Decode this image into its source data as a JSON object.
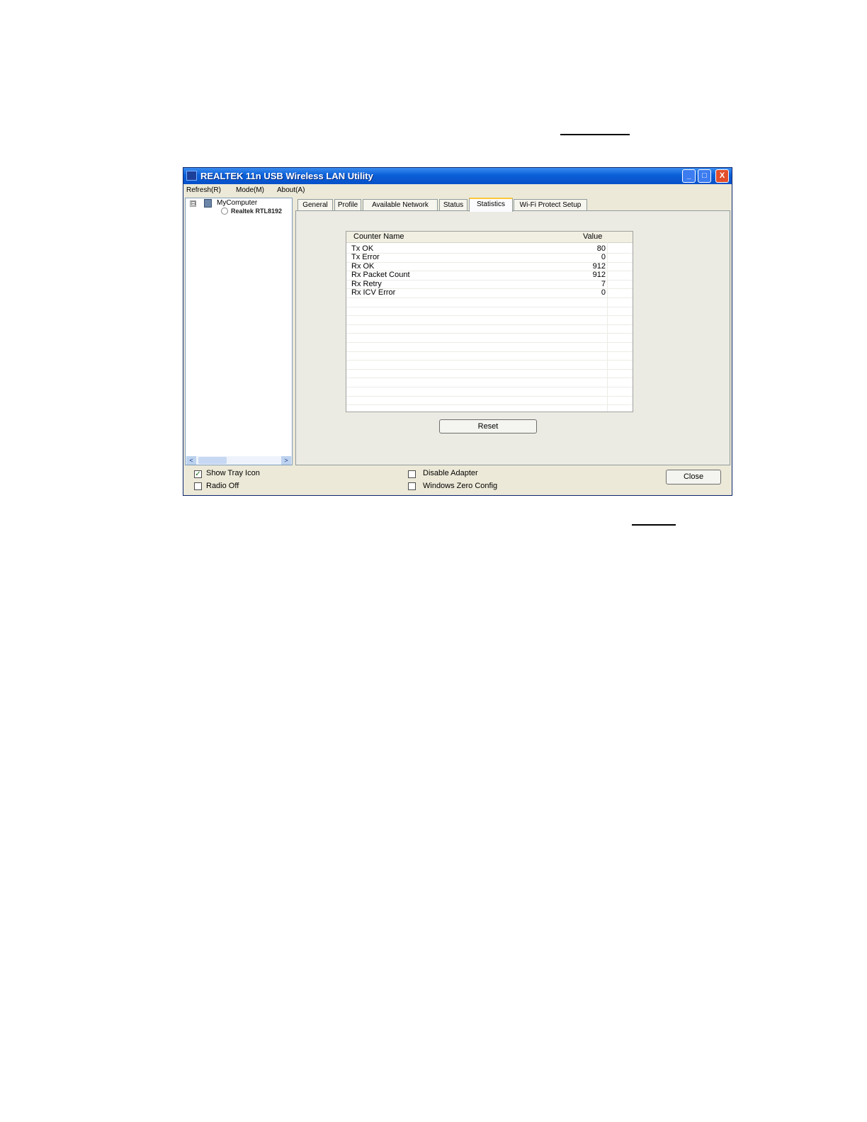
{
  "window": {
    "title": "REALTEK 11n USB Wireless LAN Utility",
    "controls": {
      "minimize": "_",
      "maximize": "□",
      "close": "X"
    }
  },
  "menu": [
    "Refresh(R)",
    "Mode(M)",
    "About(A)"
  ],
  "tree": {
    "expander": "⊟",
    "root": "MyComputer",
    "child": "Realtek RTL8192"
  },
  "scrollbar": {
    "left": "<",
    "right": ">"
  },
  "tabs": [
    {
      "label": "General"
    },
    {
      "label": "Profile"
    },
    {
      "label": "Available Network"
    },
    {
      "label": "Status"
    },
    {
      "label": "Statistics",
      "active": true
    },
    {
      "label": "Wi-Fi Protect Setup"
    }
  ],
  "statistics": {
    "columns": {
      "name": "Counter Name",
      "value": "Value"
    },
    "rows": [
      {
        "name": "Tx OK",
        "value": "80"
      },
      {
        "name": "Tx Error",
        "value": "0"
      },
      {
        "name": "Rx OK",
        "value": "912"
      },
      {
        "name": "Rx Packet Count",
        "value": "912"
      },
      {
        "name": "Rx Retry",
        "value": "7"
      },
      {
        "name": "Rx ICV Error",
        "value": "0"
      }
    ],
    "reset_label": "Reset"
  },
  "bottom": {
    "show_tray_icon": {
      "label": "Show Tray Icon",
      "checked": true,
      "mark": "✓"
    },
    "radio_off": {
      "label": "Radio Off",
      "checked": false
    },
    "disable_adapter": {
      "label": "Disable Adapter",
      "checked": false
    },
    "windows_zero_config": {
      "label": "Windows Zero Config",
      "checked": false
    },
    "close_label": "Close"
  }
}
